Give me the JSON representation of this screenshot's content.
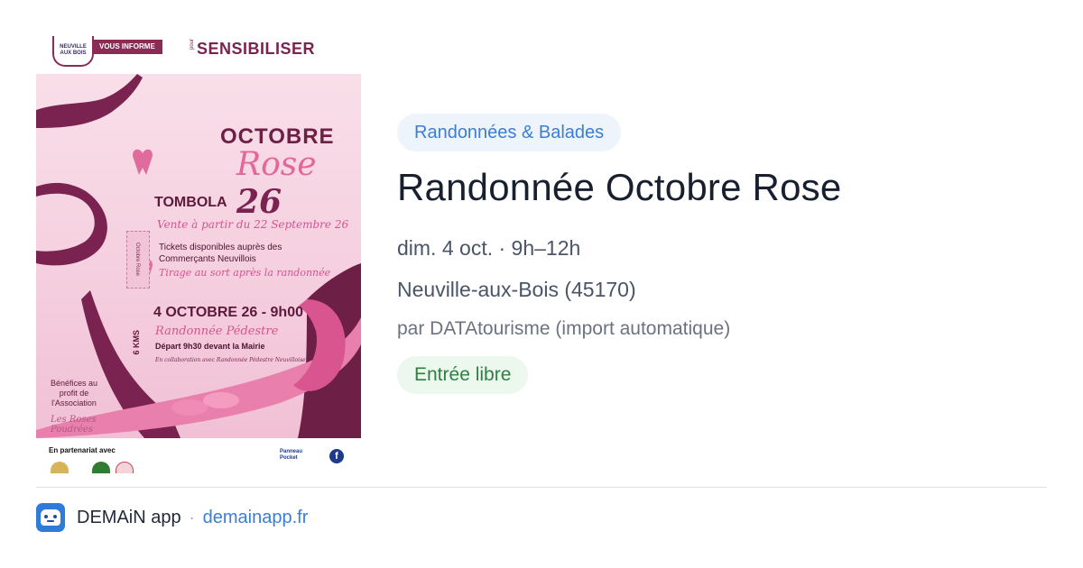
{
  "poster": {
    "logo_text": "NEUVILLE AUX BOIS",
    "informe": "VOUS INFORME",
    "pour": "pour",
    "sensibiliser": "SENSIBILISER",
    "octobre": "OCTOBRE",
    "rose": "Rose",
    "rose_num": "26",
    "tombola": "TOMBOLA",
    "vente": "Vente à partir du 22 Septembre 26",
    "tickets": "Tickets disponibles auprès des Commerçants Neuvillois",
    "tirage": "Tirage au sort après la randonnée",
    "ticket_stub": "Octobre Rose",
    "date_line": "4 OCTOBRE 26 - 9h00",
    "randonnee": "Randonnée Pédestre",
    "depart": "Départ 9h30 devant la Mairie",
    "collab": "En collaboration avec Randonnée Pédestre Neuvilloise",
    "kms": "6 KMS",
    "benefices": "Bénéfices au profit de l'Association",
    "roses_logo": "Les Roses Poudrées",
    "partenariat": "En partenariat avec",
    "panneau": "Panneau Pocket",
    "fb": "f"
  },
  "event": {
    "category": "Randonnées & Balades",
    "title": "Randonnée Octobre Rose",
    "date": "dim. 4 oct. · 9h–12h",
    "location": "Neuville-aux-Bois (45170)",
    "source": "par DATAtourisme (import automatique)",
    "price": "Entrée libre"
  },
  "footer": {
    "app_name": "DEMAiN app",
    "separator": "·",
    "domain": "demainapp.fr"
  },
  "colors": {
    "category_bg": "#eef4fc",
    "category_text": "#3b7dd8",
    "price_bg": "#ecf7ee",
    "price_text": "#2f8043",
    "brand_blue": "#2f7bd9",
    "poster_dark": "#7a2350",
    "poster_pink": "#e4679a"
  }
}
